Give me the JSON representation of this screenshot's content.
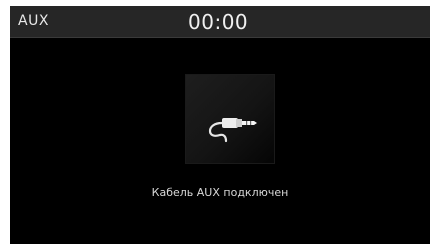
{
  "status_bar": {
    "source": "AUX",
    "time": "00:00"
  },
  "main": {
    "icon": "aux-cable-plug-icon",
    "message": "Кабель AUX подключен"
  },
  "colors": {
    "screen_background": "#000000",
    "status_bar_background": "#262626",
    "text": "#e8e8e8"
  }
}
